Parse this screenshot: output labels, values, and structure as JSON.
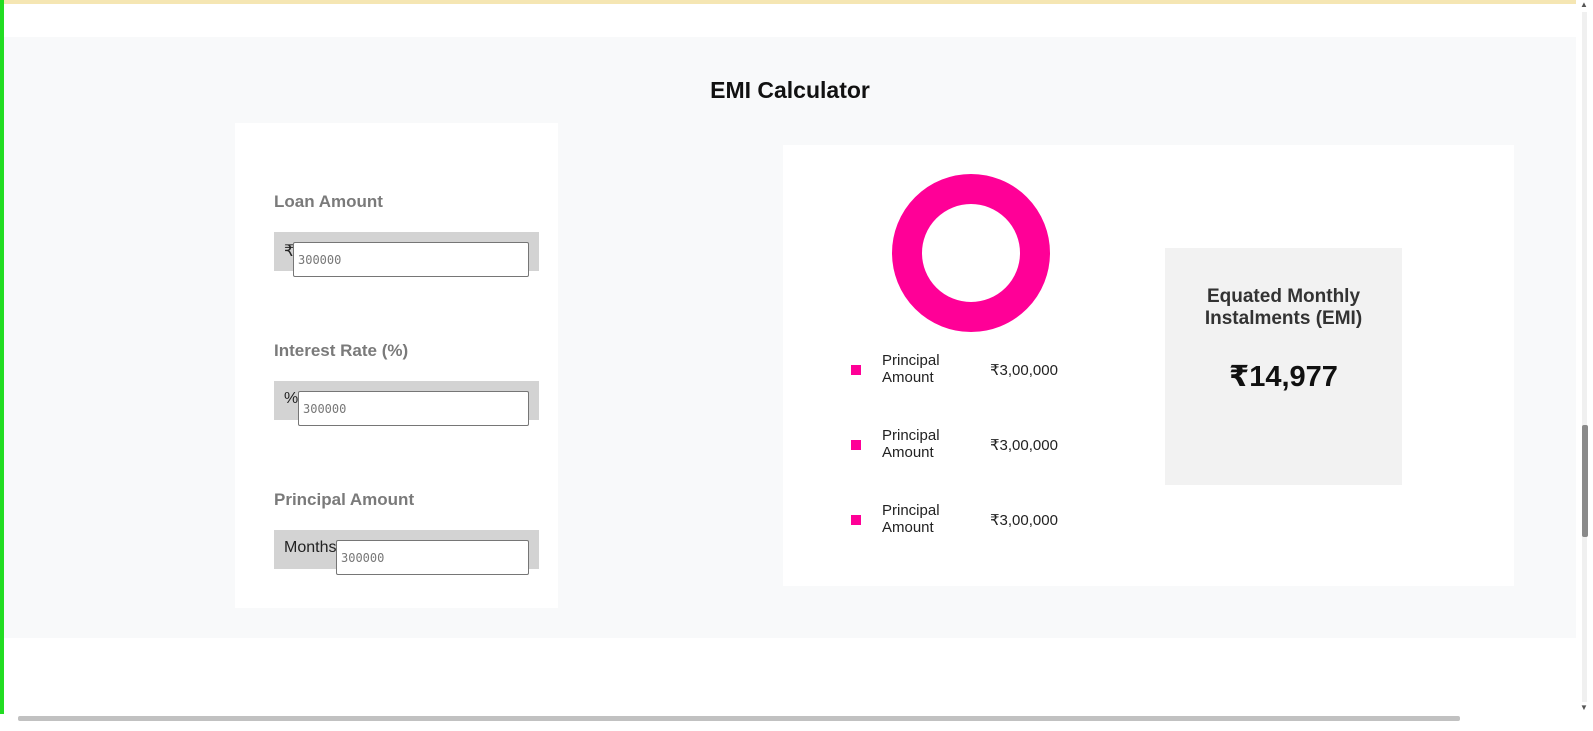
{
  "title": "EMI Calculator",
  "form": {
    "loan_amount": {
      "label": "Loan Amount",
      "prefix": "₹",
      "placeholder": "300000"
    },
    "interest_rate": {
      "label": "Interest Rate (%)",
      "prefix": "%",
      "placeholder": "300000"
    },
    "principal_amount": {
      "label": "Principal Amount",
      "prefix": "Months",
      "placeholder": "300000"
    }
  },
  "breakdown": {
    "items": [
      {
        "label": "Principal Amount",
        "value": "₹3,00,000"
      },
      {
        "label": "Principal Amount",
        "value": "₹3,00,000"
      },
      {
        "label": "Principal Amount",
        "value": "₹3,00,000"
      }
    ],
    "donut_shares": [
      1.0
    ],
    "color": "#ff0097"
  },
  "emi": {
    "label": "Equated Monthly Instalments (EMI)",
    "value": "₹14,977"
  }
}
